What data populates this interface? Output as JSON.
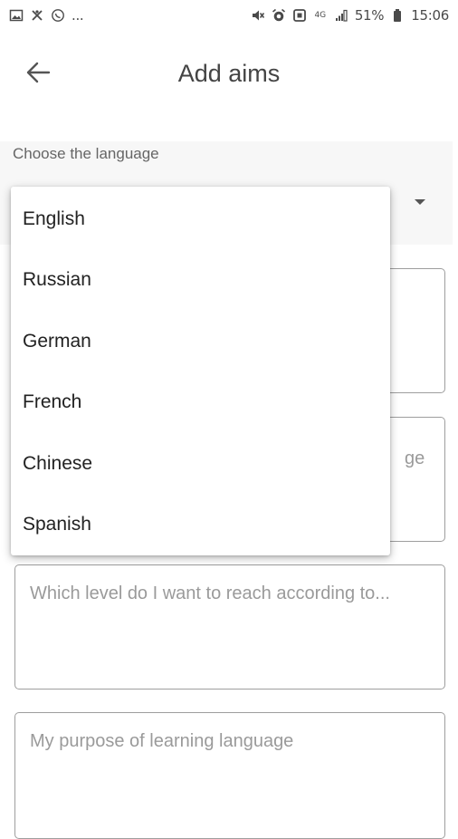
{
  "status_bar": {
    "ellipsis": "...",
    "network_small": "4G",
    "battery_percent": "51%",
    "time": "15:06",
    "icons_left": [
      "image-icon",
      "sync-icon",
      "whatsapp-icon"
    ],
    "icons_right": [
      "mute-icon",
      "alarm-icon",
      "nfc-icon",
      "data-icon",
      "signal-icon",
      "battery-icon"
    ]
  },
  "app_bar": {
    "title": "Add aims",
    "back_icon": "arrow-left-icon"
  },
  "language_select": {
    "label": "Choose the language",
    "options": [
      "English",
      "Russian",
      "German",
      "French",
      "Chinese",
      "Spanish"
    ]
  },
  "fields": {
    "field1_placeholder": "",
    "field2_partial": "ge",
    "level_placeholder": "Which level do I want to reach according to...",
    "purpose_placeholder": "My purpose of learning language"
  }
}
